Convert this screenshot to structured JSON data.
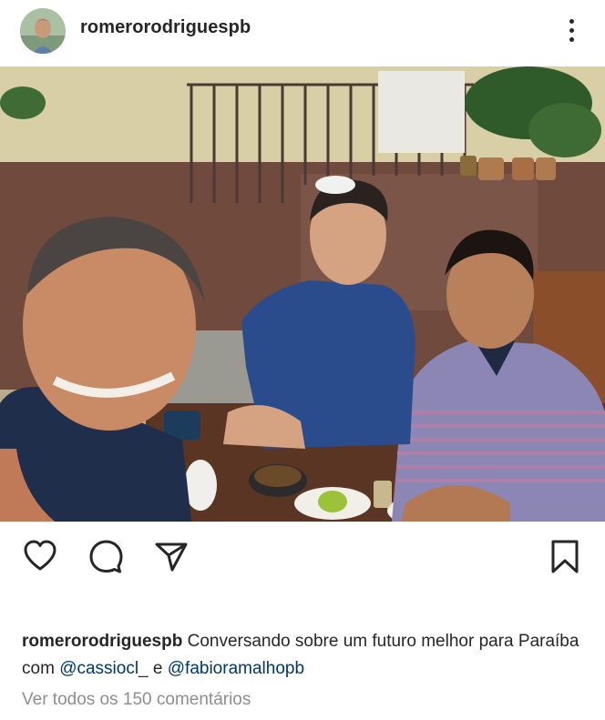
{
  "post": {
    "username": "romerorodriguespb",
    "image_alt": "",
    "caption": {
      "username": "romerorodriguespb",
      "text_part1": "Conversando sobre um futuro melhor para Paraíba com",
      "mention1": "@cassiocl_",
      "conjunction": "e",
      "mention2": "@fabioramalhopb"
    },
    "comments_link": "Ver todos os 150 comentários"
  },
  "icons": {
    "more": "more-vertical-icon",
    "like": "heart-icon",
    "comment": "comment-icon",
    "share": "send-icon",
    "save": "bookmark-icon"
  },
  "colors": {
    "text": "#262626",
    "mention": "#00376b",
    "muted": "#8e8e8e"
  }
}
